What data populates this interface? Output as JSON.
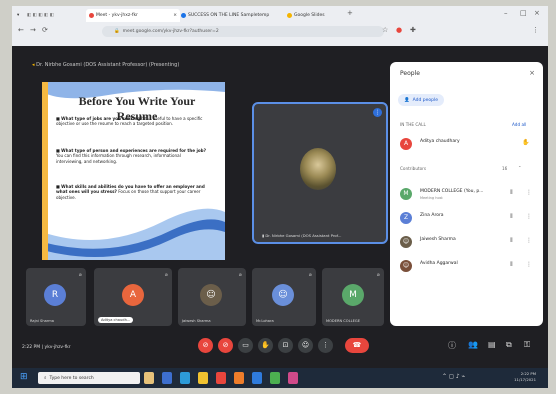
{
  "browser": {
    "tabs": [
      {
        "label": "Meet - ykv-jhxz-fkr",
        "color": "#e8463d"
      },
      {
        "label": "SUCCESS ON THE LINE Sampletemp",
        "color": "#1a73e8"
      },
      {
        "label": "Google Slides",
        "color": "#f4b400"
      }
    ],
    "url": "meet.google.com/ykv-jhzv-fkr?authuser=2"
  },
  "meet": {
    "title": "Dr. Nirbhe Gosami (DOS Assistant Professor) (Presenting)",
    "slide": {
      "heading": "Before You Write Your Resume",
      "bullets": [
        {
          "bold": "What type of jobs are you seeking?",
          "text": " It is useful to have a specific objective or use the resume to reach a targeted position."
        },
        {
          "bold": "What type of person and experiences are required for the job?",
          "text": " You can find this information through research, informational interviewing, and networking."
        },
        {
          "bold": "What skills and abilities do you have to offer an employer and what ones will you stress?",
          "text": " Focus on those that support your career objective."
        }
      ]
    },
    "camera_tile": {
      "name": "Dr. Nirbhe Gosami (DOS Assistant Prof..."
    },
    "thumbnails": [
      {
        "name": "Rajni Sharma",
        "initial": "R",
        "color": "#5b7fd6"
      },
      {
        "name": "Aditya chaudh...",
        "initial": "A",
        "color": "#e8663d"
      },
      {
        "name": "Jaiwesh Sharma",
        "initial": "",
        "color": "#6b5e4a"
      },
      {
        "name": "Mr.Lohara",
        "initial": "",
        "color": "#6a8fd9"
      },
      {
        "name": "MODERN COLLEGE",
        "initial": "M",
        "color": "#5aa86a"
      }
    ],
    "time": "2:22 PM",
    "meeting_code": "ykv-jhzv-fkr"
  },
  "people": {
    "title": "People",
    "add_people": "Add people",
    "in_call_label": "IN THE CALL",
    "add_label": "Add all",
    "host": {
      "name": "Aditya chaudhary",
      "initial": "A",
      "color": "#e8463d"
    },
    "contributors_label": "Contributors",
    "contributors_count": "16",
    "contributors": [
      {
        "name": "MODERN COLLEGE (You, p...",
        "sub": "Meeting host",
        "initial": "M",
        "color": "#5aa86a"
      },
      {
        "name": "Zina Arora",
        "sub": "",
        "initial": "Z",
        "color": "#5b7fd6"
      },
      {
        "name": "Jaiwesh Sharma",
        "sub": "",
        "initial": "",
        "color": "#6b5e4a"
      },
      {
        "name": "Avidha Aggarwal",
        "sub": "",
        "initial": "",
        "color": "#7a4f3a"
      }
    ]
  },
  "taskbar": {
    "search_placeholder": "Type here to search",
    "time": "2:22 PM",
    "date": "11/17/2021"
  }
}
